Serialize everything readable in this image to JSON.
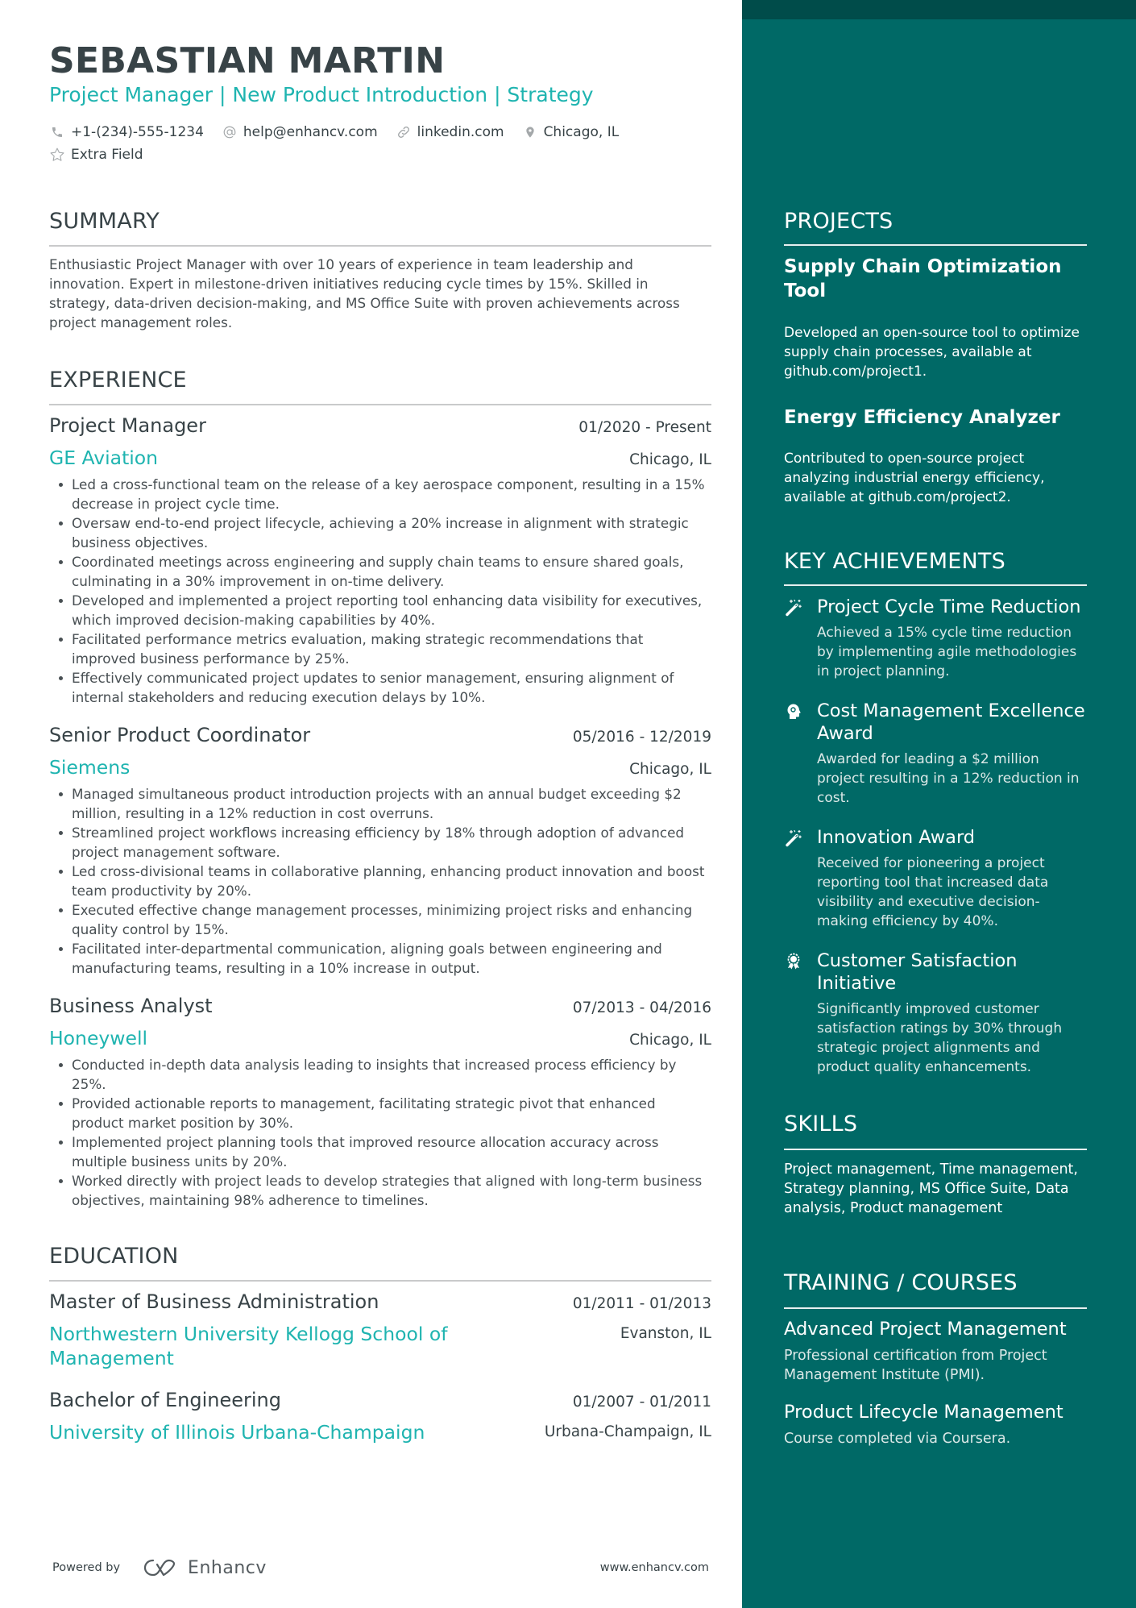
{
  "colors": {
    "accent": "#1fb4b0",
    "sidebar": "#006966",
    "sidebar_band": "#004c4a",
    "text": "#384347"
  },
  "header": {
    "name": "SEBASTIAN MARTIN",
    "title": "Project Manager | New Product Introduction | Strategy",
    "contacts": [
      {
        "icon": "phone-icon",
        "text": "+1-(234)-555-1234"
      },
      {
        "icon": "at-icon",
        "text": "help@enhancv.com"
      },
      {
        "icon": "link-icon",
        "text": "linkedin.com"
      },
      {
        "icon": "location-pin-icon",
        "text": "Chicago, IL"
      }
    ],
    "extra": {
      "icon": "star-icon",
      "text": "Extra Field"
    }
  },
  "summary": {
    "heading": "SUMMARY",
    "text": "Enthusiastic Project Manager with over 10 years of experience in team leadership and innovation. Expert in milestone-driven initiatives reducing cycle times by 15%. Skilled in strategy, data-driven decision-making, and MS Office Suite with proven achievements across project management roles."
  },
  "experience": {
    "heading": "EXPERIENCE",
    "items": [
      {
        "role": "Project Manager",
        "dates": "01/2020 - Present",
        "company": "GE Aviation",
        "location": "Chicago, IL",
        "bullets": [
          "Led a cross-functional team on the release of a key aerospace component, resulting in a 15% decrease in project cycle time.",
          "Oversaw end-to-end project lifecycle, achieving a 20% increase in alignment with strategic business objectives.",
          "Coordinated meetings across engineering and supply chain teams to ensure shared goals, culminating in a 30% improvement in on-time delivery.",
          "Developed and implemented a project reporting tool enhancing data visibility for executives, which improved decision-making capabilities by 40%.",
          "Facilitated performance metrics evaluation, making strategic recommendations that improved business performance by 25%.",
          "Effectively communicated project updates to senior management, ensuring alignment of internal stakeholders and reducing execution delays by 10%."
        ]
      },
      {
        "role": "Senior Product Coordinator",
        "dates": "05/2016 - 12/2019",
        "company": "Siemens",
        "location": "Chicago, IL",
        "bullets": [
          "Managed simultaneous product introduction projects with an annual budget exceeding $2 million, resulting in a 12% reduction in cost overruns.",
          "Streamlined project workflows increasing efficiency by 18% through adoption of advanced project management software.",
          "Led cross-divisional teams in collaborative planning, enhancing product innovation and boost team productivity by 20%.",
          "Executed effective change management processes, minimizing project risks and enhancing quality control by 15%.",
          "Facilitated inter-departmental communication, aligning goals between engineering and manufacturing teams, resulting in a 10% increase in output."
        ]
      },
      {
        "role": "Business Analyst",
        "dates": "07/2013 - 04/2016",
        "company": "Honeywell",
        "location": "Chicago, IL",
        "bullets": [
          "Conducted in-depth data analysis leading to insights that increased process efficiency by 25%.",
          "Provided actionable reports to management, facilitating strategic pivot that enhanced product market position by 30%.",
          "Implemented project planning tools that improved resource allocation accuracy across multiple business units by 20%.",
          "Worked directly with project leads to develop strategies that aligned with long-term business objectives, maintaining 98% adherence to timelines."
        ]
      }
    ]
  },
  "education": {
    "heading": "EDUCATION",
    "items": [
      {
        "degree": "Master of Business Administration",
        "dates": "01/2011 - 01/2013",
        "school": "Northwestern University Kellogg School of Management",
        "location": "Evanston, IL"
      },
      {
        "degree": "Bachelor of Engineering",
        "dates": "01/2007 - 01/2011",
        "school": "University of Illinois Urbana-Champaign",
        "location": "Urbana-Champaign, IL"
      }
    ]
  },
  "footer": {
    "powered_by": "Powered by",
    "brand": "Enhancv",
    "website": "www.enhancv.com"
  },
  "projects": {
    "heading": "PROJECTS",
    "items": [
      {
        "name": "Supply Chain Optimization Tool",
        "description": "Developed an open-source tool to optimize supply chain processes, available at github.com/project1."
      },
      {
        "name": "Energy Efficiency Analyzer",
        "description": "Contributed to open-source project analyzing industrial energy efficiency, available at github.com/project2."
      }
    ]
  },
  "achievements": {
    "heading": "KEY ACHIEVEMENTS",
    "items": [
      {
        "icon": "magic-wand-icon",
        "title": "Project Cycle Time Reduction",
        "description": "Achieved a 15% cycle time reduction by implementing agile methodologies in project planning."
      },
      {
        "icon": "head-idea-icon",
        "title": "Cost Management Excellence Award",
        "description": "Awarded for leading a $2 million project resulting in a 12% reduction in cost."
      },
      {
        "icon": "magic-wand-icon",
        "title": "Innovation Award",
        "description": "Received for pioneering a project reporting tool that increased data visibility and executive decision-making efficiency by 40%."
      },
      {
        "icon": "award-ribbon-icon",
        "title": "Customer Satisfaction Initiative",
        "description": "Significantly improved customer satisfaction ratings by 30% through strategic project alignments and product quality enhancements."
      }
    ]
  },
  "skills": {
    "heading": "SKILLS",
    "text": "Project management, Time management, Strategy planning, MS Office Suite, Data analysis, Product management"
  },
  "training": {
    "heading": "TRAINING / COURSES",
    "items": [
      {
        "name": "Advanced Project Management",
        "description": "Professional certification from Project Management Institute (PMI)."
      },
      {
        "name": "Product Lifecycle Management",
        "description": "Course completed via Coursera."
      }
    ]
  }
}
